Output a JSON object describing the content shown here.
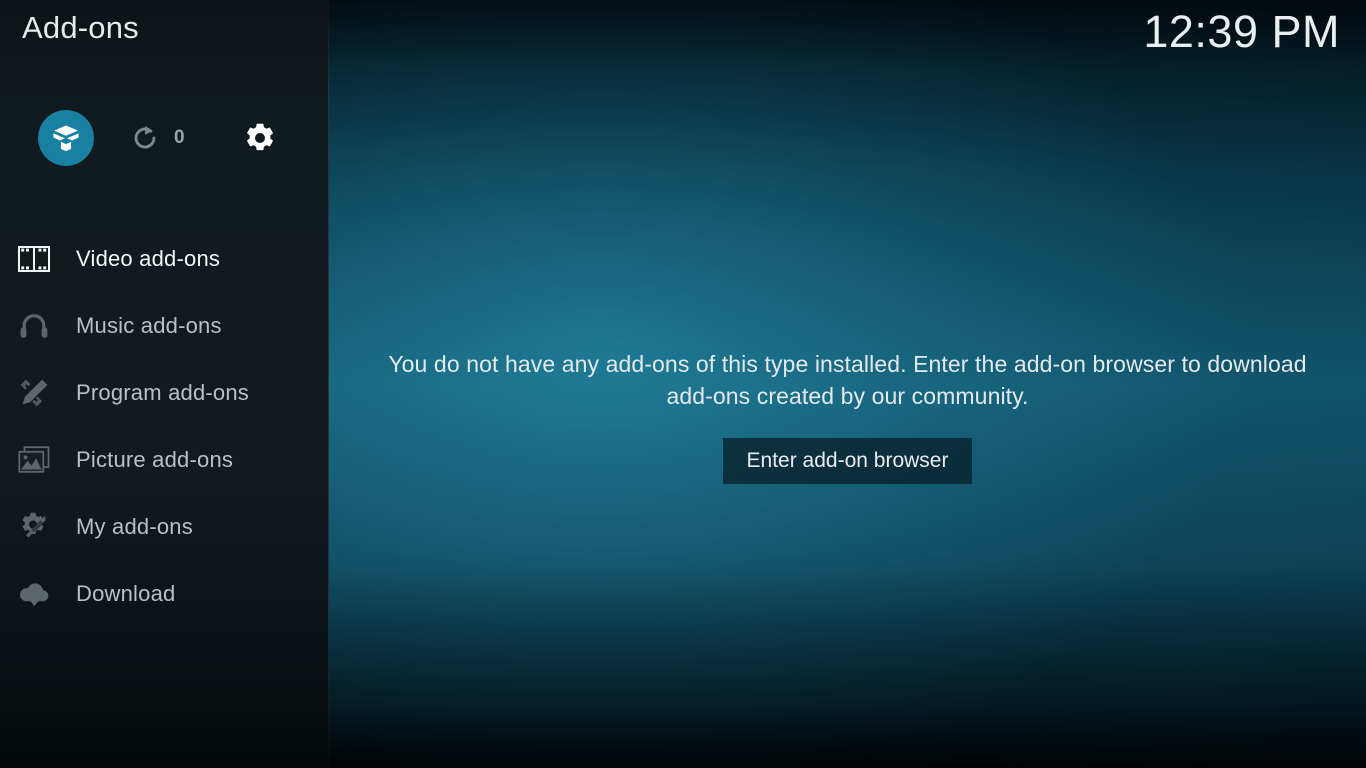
{
  "header": {
    "title": "Add-ons",
    "clock": "12:39 PM"
  },
  "toolbar": {
    "addon_browser_label": "Add-on browser",
    "addon_browser_icon": "open-box-icon",
    "update_icon": "refresh-icon",
    "update_count": "0",
    "settings_label": "Settings",
    "settings_icon": "gear-icon"
  },
  "sidebar": {
    "items": [
      {
        "label": "Video add-ons",
        "icon": "film-strip-icon",
        "focused": true
      },
      {
        "label": "Music add-ons",
        "icon": "headphones-icon",
        "focused": false
      },
      {
        "label": "Program add-ons",
        "icon": "pencil-ruler-icon",
        "focused": false
      },
      {
        "label": "Picture add-ons",
        "icon": "pictures-icon",
        "focused": false
      },
      {
        "label": "My add-ons",
        "icon": "gear-screwdriver-icon",
        "focused": false
      },
      {
        "label": "Download",
        "icon": "cloud-download-icon",
        "focused": false
      }
    ]
  },
  "main": {
    "empty_message": "You do not have any add-ons of this type installed. Enter the add-on browser to download add-ons created by our community.",
    "enter_browser_label": "Enter add-on browser"
  },
  "colors": {
    "accent": "#1880a1",
    "sidebar_bg": "#111a1e",
    "content_bg": "#11536a",
    "text_primary": "#e6ebed",
    "text_dim": "#b9c1c4",
    "button_bg": "#081a24"
  }
}
